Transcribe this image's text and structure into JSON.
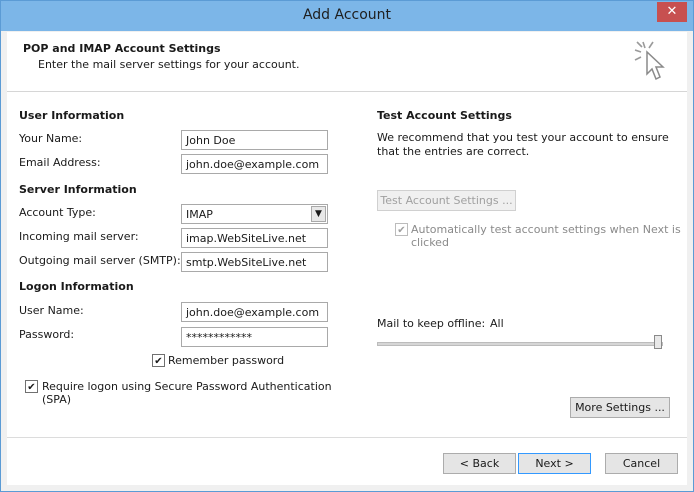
{
  "window": {
    "title": "Add Account",
    "close_label": "✕"
  },
  "header": {
    "title": "POP and IMAP Account Settings",
    "subtitle": "Enter the mail server settings for your account.",
    "icon": "cursor-click-icon"
  },
  "user_info": {
    "section": "User Information",
    "name_label": "Your Name:",
    "name_value": "John Doe",
    "email_label": "Email Address:",
    "email_value": "john.doe@example.com"
  },
  "server_info": {
    "section": "Server Information",
    "account_type_label": "Account Type:",
    "account_type_value": "IMAP",
    "incoming_label": "Incoming mail server:",
    "incoming_value": "imap.WebSiteLive.net",
    "outgoing_label": "Outgoing mail server (SMTP):",
    "outgoing_value": "smtp.WebSiteLive.net"
  },
  "logon_info": {
    "section": "Logon Information",
    "username_label": "User Name:",
    "username_value": "john.doe@example.com",
    "password_label": "Password:",
    "password_value": "************",
    "remember_label": "Remember password",
    "remember_checked": true,
    "spa_label": "Require logon using Secure Password Authentication (SPA)",
    "spa_checked": true
  },
  "test_settings": {
    "section": "Test Account Settings",
    "description": "We recommend that you test your account to ensure that the entries are correct.",
    "test_button": "Test Account Settings ...",
    "auto_test_label": "Automatically test account settings when Next is clicked",
    "auto_test_checked": true
  },
  "offline": {
    "label": "Mail to keep offline:",
    "value": "All",
    "slider_position": 1.0
  },
  "buttons": {
    "more_settings": "More Settings ...",
    "back": "< Back",
    "next": "Next >",
    "cancel": "Cancel"
  }
}
